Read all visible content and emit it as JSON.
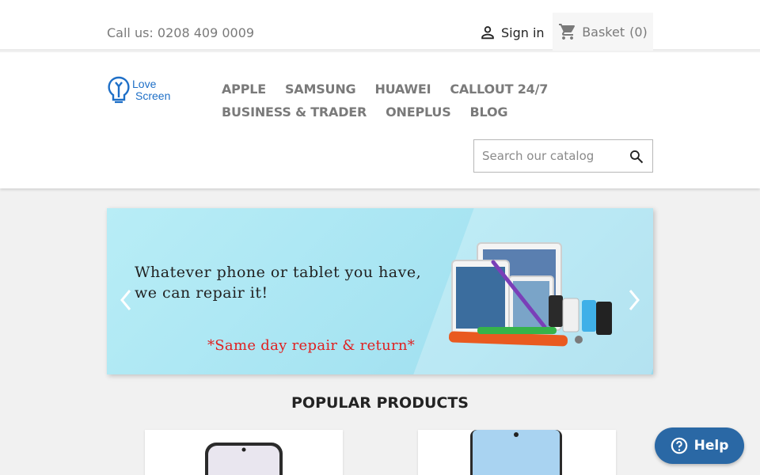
{
  "topbar": {
    "contact": "Call us: 0208 409 0009",
    "signin_label": "Sign in",
    "basket_label": "Basket",
    "basket_count": "(0)"
  },
  "header": {
    "logo": {
      "line1": "Love",
      "line2": "Screen"
    },
    "nav": [
      "APPLE",
      "SAMSUNG",
      "HUAWEI",
      "CALLOUT 24/7",
      "BUSINESS & TRADER",
      "ONEPLUS",
      "BLOG"
    ],
    "search_placeholder": "Search our catalog"
  },
  "carousel": {
    "line1": "Whatever phone or tablet you have,",
    "line2": "we can repair it!",
    "note": "*Same day repair & return*"
  },
  "products": {
    "section_title": "POPULAR PRODUCTS"
  },
  "help": {
    "label": "Help"
  },
  "colors": {
    "accent": "#2a68a5",
    "logo": "#1e6fc7",
    "promo_red": "#e02020",
    "banner": "#b8edf6"
  }
}
